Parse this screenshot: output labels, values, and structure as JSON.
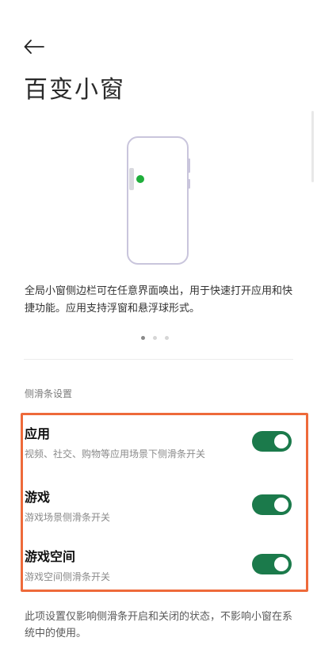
{
  "header": {
    "back_icon": "arrow-left-icon",
    "title": "百变小窗"
  },
  "illustration": {
    "icon": "phone-illustration",
    "accent_color": "#1fae3b"
  },
  "description": "全局小窗侧边栏可在任意界面唤出，用于快速打开应用和快捷功能。应用支持浮窗和悬浮球形式。",
  "carousel": {
    "page_count": 3,
    "active_index": 0
  },
  "section": {
    "label": "侧滑条设置"
  },
  "settings": [
    {
      "name": "应用",
      "subtitle": "视频、社交、购物等应用场景下侧滑条开关",
      "enabled": true
    },
    {
      "name": "游戏",
      "subtitle": "游戏场景侧滑条开关",
      "enabled": true
    },
    {
      "name": "游戏空间",
      "subtitle": "游戏空间侧滑条开关",
      "enabled": true
    }
  ],
  "footer_note": "此项设置仅影响侧滑条开启和关闭的状态，不影响小窗在系统中的使用。",
  "colors": {
    "toggle_on": "#1b7a4b",
    "highlight_border": "#ee6a3a"
  }
}
